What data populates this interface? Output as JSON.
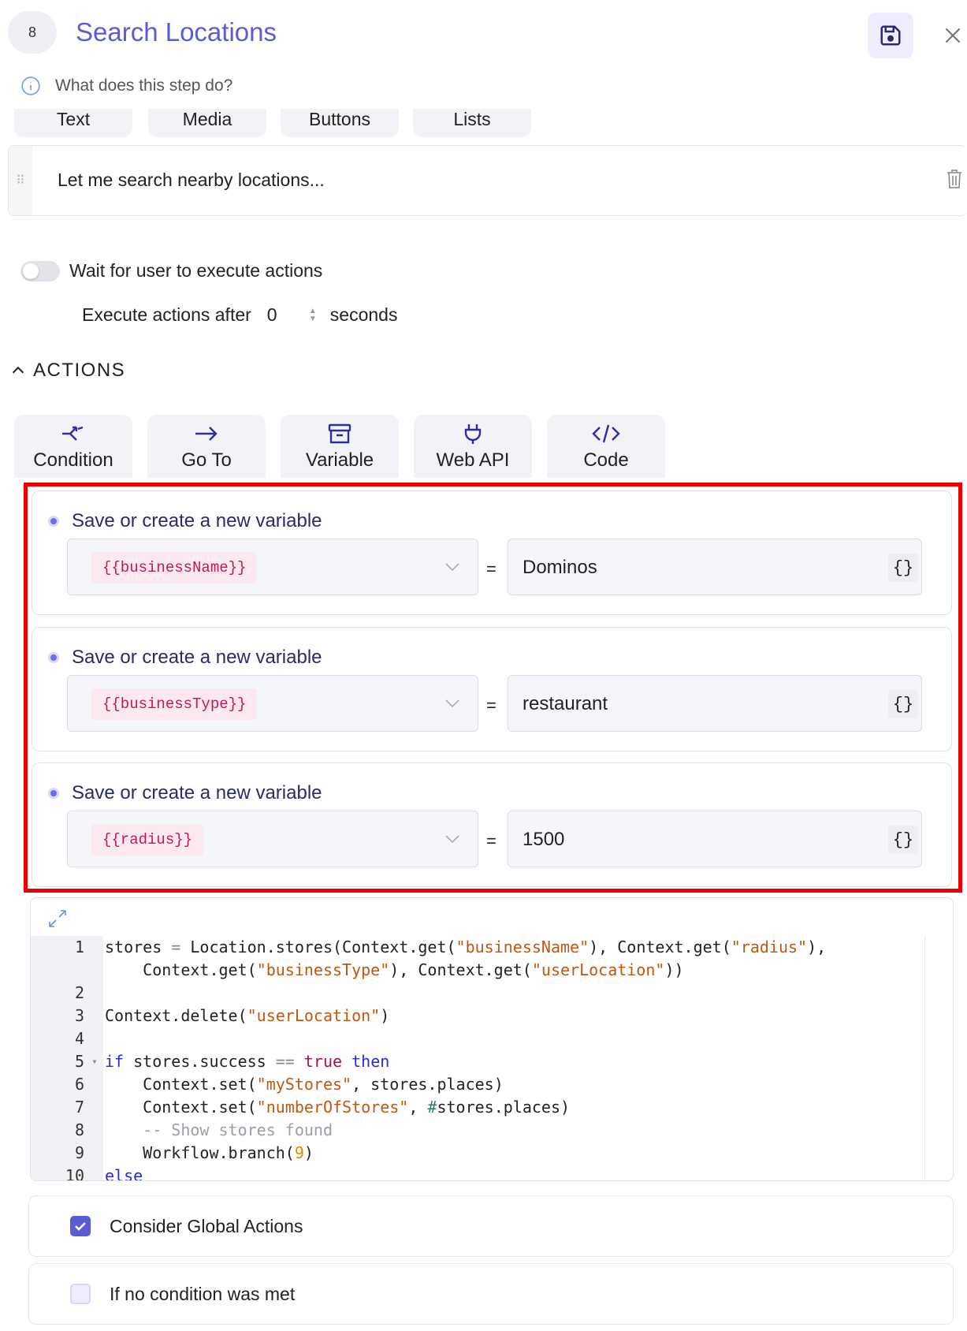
{
  "header": {
    "step_number": "8",
    "title": "Search Locations",
    "description_placeholder": "What does this step do?"
  },
  "message_tabs": [
    "Text",
    "Media",
    "Buttons",
    "Lists"
  ],
  "message": {
    "text": "Let me search nearby locations..."
  },
  "wait": {
    "label": "Wait for user to execute actions",
    "enabled": false
  },
  "execute": {
    "prefix": "Execute actions after",
    "value": "0",
    "suffix": "seconds"
  },
  "actions": {
    "header": "ACTIONS",
    "types": [
      {
        "label": "Condition",
        "icon": "condition-icon"
      },
      {
        "label": "Go To",
        "icon": "arrow-right-icon"
      },
      {
        "label": "Variable",
        "icon": "archive-box-icon"
      },
      {
        "label": "Web API",
        "icon": "plug-icon"
      },
      {
        "label": "Code",
        "icon": "code-icon"
      }
    ]
  },
  "variables": [
    {
      "title": "Save or create a new variable",
      "name": "{{businessName}}",
      "equals": "=",
      "value": "Dominos",
      "braces": "{}"
    },
    {
      "title": "Save or create a new variable",
      "name": "{{businessType}}",
      "equals": "=",
      "value": "restaurant",
      "braces": "{}"
    },
    {
      "title": "Save or create a new variable",
      "name": "{{radius}}",
      "equals": "=",
      "value": "1500",
      "braces": "{}"
    }
  ],
  "code": {
    "line_numbers": [
      "1",
      "",
      "2",
      "3",
      "4",
      "5",
      "6",
      "7",
      "8",
      "9",
      "10"
    ],
    "lines": [
      "stores = Location.stores(Context.get(\"businessName\"), Context.get(\"radius\"),",
      "    Context.get(\"businessType\"), Context.get(\"userLocation\"))",
      "",
      "Context.delete(\"userLocation\")",
      "",
      "if stores.success == true then",
      "    Context.set(\"myStores\", stores.places)",
      "    Context.set(\"numberOfStores\", #stores.places)",
      "    -- Show stores found",
      "    Workflow.branch(9)",
      "else"
    ]
  },
  "options": [
    {
      "label": "Consider Global Actions",
      "checked": true
    },
    {
      "label": "If no condition was met",
      "checked": false
    }
  ],
  "colors": {
    "accent": "#5b5bd6",
    "highlight": "#ee0000",
    "chip_text": "#c2185b"
  }
}
